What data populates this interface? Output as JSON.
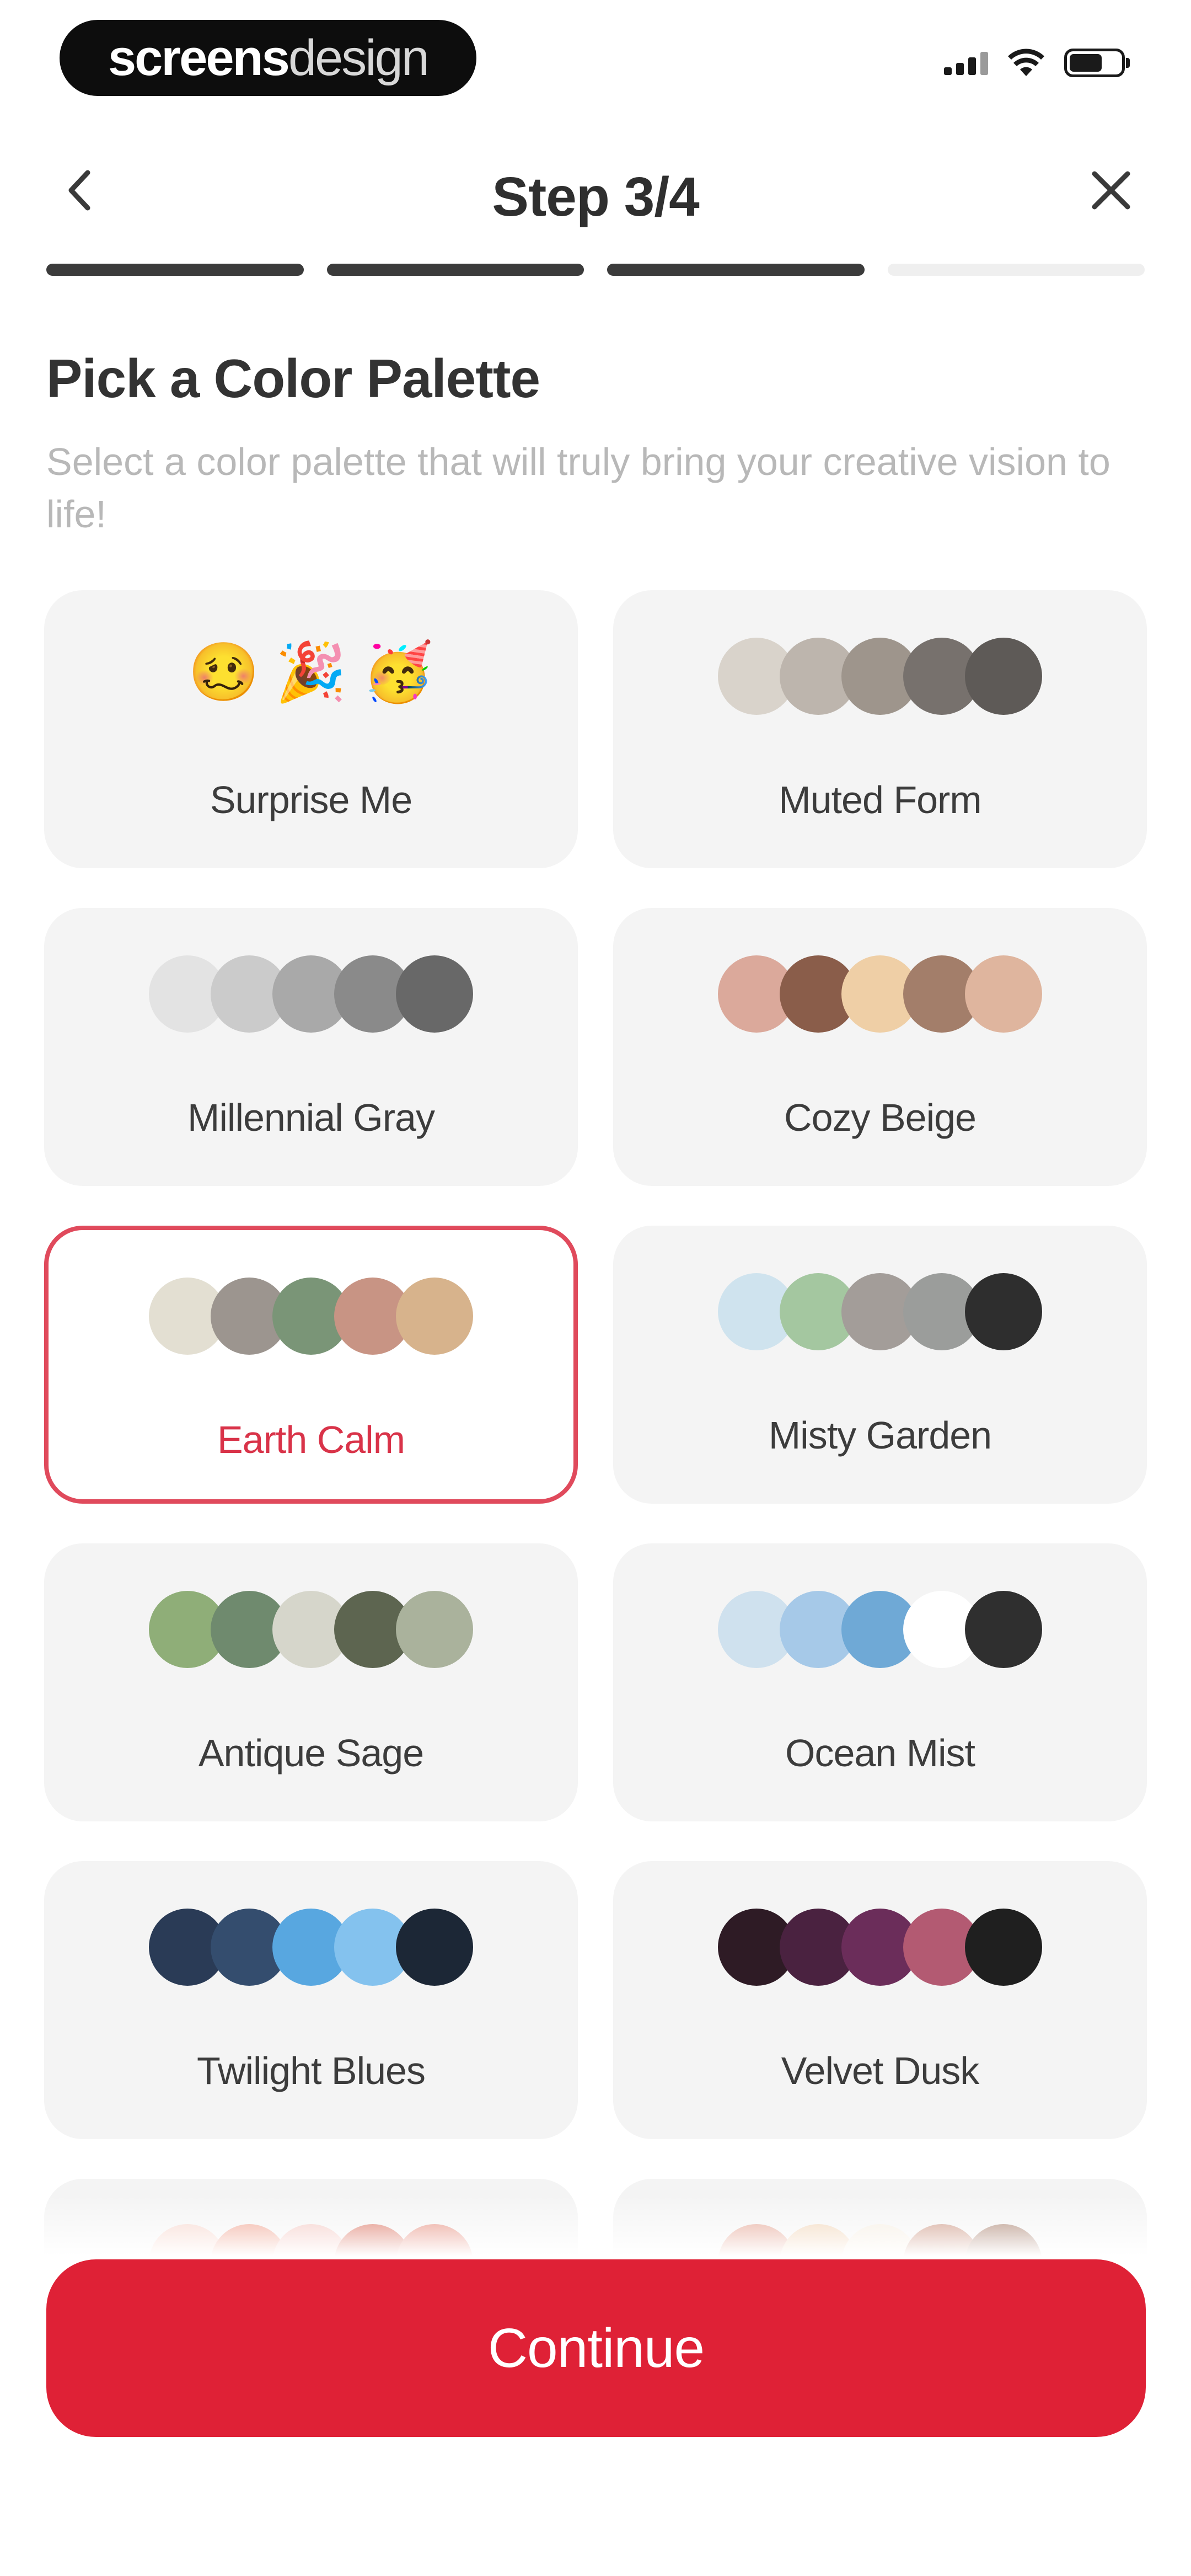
{
  "status_bar": {
    "brand_bold": "screens",
    "brand_light": "design"
  },
  "header": {
    "title": "Step 3/4",
    "back_icon": "chevron-left-icon",
    "close_icon": "close-icon"
  },
  "progress": {
    "total_steps": 4,
    "completed_steps": 3
  },
  "main": {
    "title": "Pick a Color Palette",
    "subtitle": "Select a color palette that will truly bring your creative vision to life!",
    "selected_palette": "Earth Calm",
    "palettes": [
      {
        "name": "Surprise Me",
        "emojis": [
          "🥴",
          "🎉",
          "🥳"
        ],
        "colors": []
      },
      {
        "name": "Muted Form",
        "colors": [
          "#d9d3cb",
          "#bdb5ad",
          "#9e958c",
          "#77716d",
          "#5e5a57"
        ]
      },
      {
        "name": "Millennial Gray",
        "colors": [
          "#e3e3e3",
          "#cbcbcb",
          "#a9a9a9",
          "#8a8a8a",
          "#686868"
        ]
      },
      {
        "name": "Cozy Beige",
        "colors": [
          "#dba99b",
          "#8a5d4a",
          "#efcfa6",
          "#a37e6a",
          "#dfb59e"
        ]
      },
      {
        "name": "Earth Calm",
        "colors": [
          "#e3dfd2",
          "#9c958f",
          "#7a9577",
          "#c89484",
          "#d7b38c"
        ]
      },
      {
        "name": "Misty Garden",
        "colors": [
          "#cfe3ee",
          "#a4c7a0",
          "#a39d99",
          "#9b9d9b",
          "#2e2e2e"
        ]
      },
      {
        "name": "Antique Sage",
        "colors": [
          "#8fae78",
          "#6f8a6e",
          "#d6d6cb",
          "#5d6550",
          "#aab29c"
        ]
      },
      {
        "name": "Ocean Mist",
        "colors": [
          "#cfe1ee",
          "#a6c9e8",
          "#6fa9d6",
          "#ffffff",
          "#2f2f2f"
        ]
      },
      {
        "name": "Twilight Blues",
        "colors": [
          "#2a3b56",
          "#344d6e",
          "#58a7e0",
          "#84c2ee",
          "#1c2736"
        ]
      },
      {
        "name": "Velvet Dusk",
        "colors": [
          "#2e1b25",
          "#4a2240",
          "#6b2d5a",
          "#b35a72",
          "#1f1f1f"
        ]
      },
      {
        "name": "",
        "colors": [
          "#f6d3c9",
          "#ef9e8a",
          "#f3c6c0",
          "#d96e5c",
          "#e58a7a"
        ]
      },
      {
        "name": "",
        "colors": [
          "#e3a08e",
          "#f0d2b3",
          "#f5ede0",
          "#c9907c",
          "#a67d6a"
        ]
      }
    ]
  },
  "footer": {
    "continue_label": "Continue"
  }
}
